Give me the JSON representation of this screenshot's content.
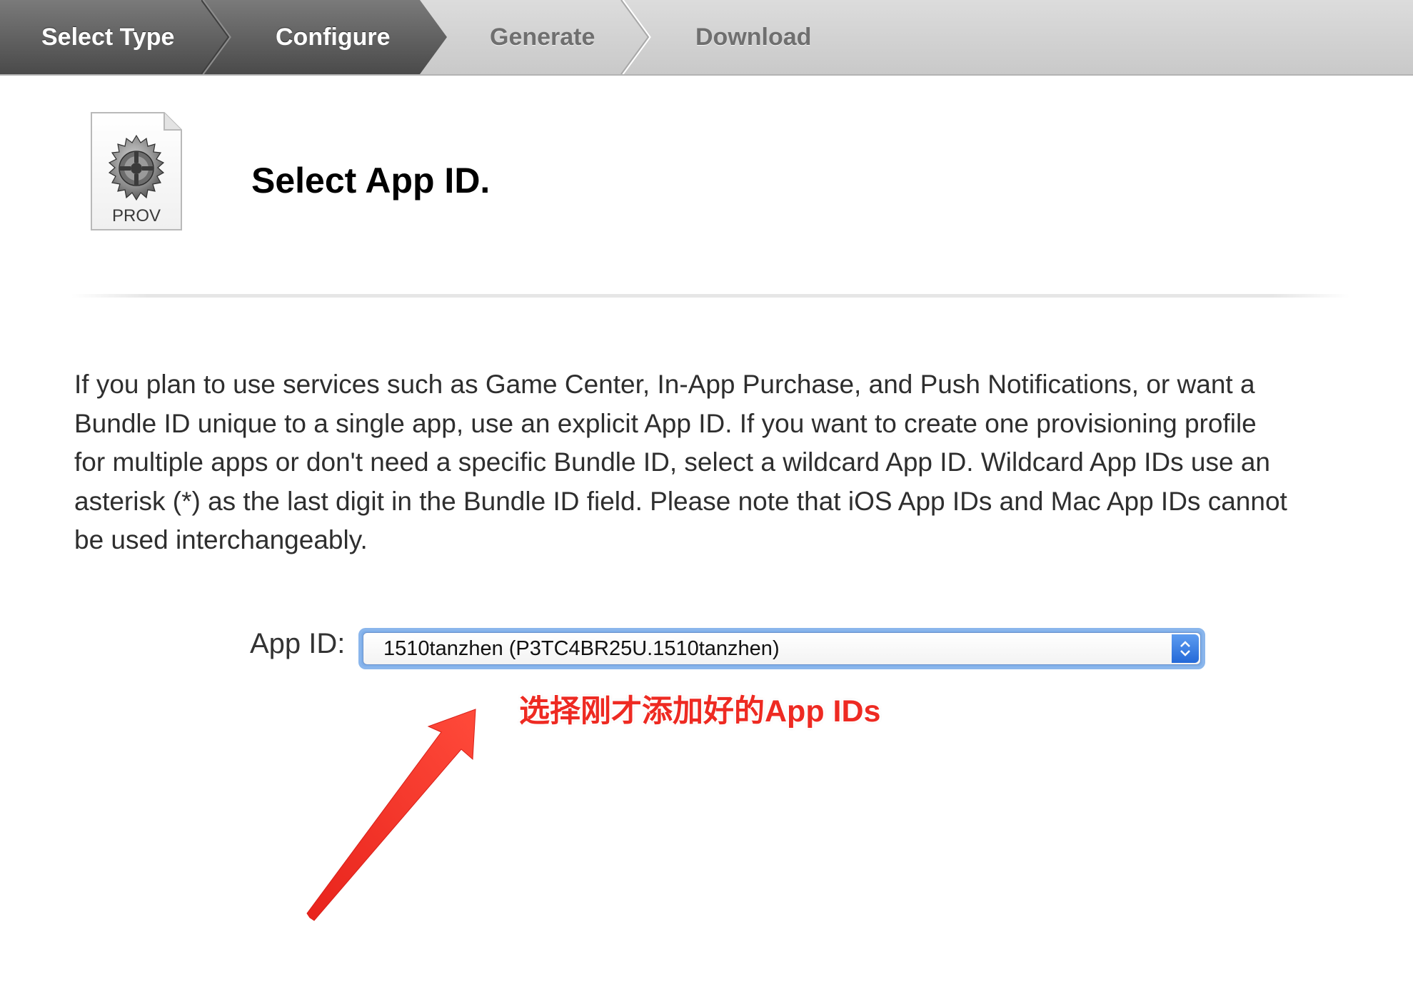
{
  "steps": [
    {
      "label": "Select Type",
      "state": "completed"
    },
    {
      "label": "Configure",
      "state": "active"
    },
    {
      "label": "Generate",
      "state": "pending"
    },
    {
      "label": "Download",
      "state": "pending"
    }
  ],
  "header": {
    "icon_label": "PROV",
    "icon": "gear-document-icon",
    "title": "Select App ID."
  },
  "description": "If you plan to use services such as Game Center, In-App Purchase, and Push Notifications, or want a Bundle ID unique to a single app, use an explicit App ID. If you want to create one provisioning profile for multiple apps or don't need a specific Bundle ID, select a wildcard App ID. Wildcard App IDs use an asterisk (*) as the last digit in the Bundle ID field. Please note that iOS App IDs and Mac App IDs cannot be used interchangeably.",
  "app_id_select": {
    "label": "App ID:",
    "selected_value": "1510tanzhen (P3TC4BR25U.1510tanzhen)",
    "icon": "updown-chevron-icon"
  },
  "annotation": {
    "text": "选择刚才添加好的App IDs",
    "color": "#ee2a22",
    "icon": "red-arrow"
  },
  "colors": {
    "step_active": "#5a5a5a",
    "step_inactive": "#cfcfcf",
    "select_focus": "#7eaee9",
    "annotation": "#ee2a22"
  }
}
